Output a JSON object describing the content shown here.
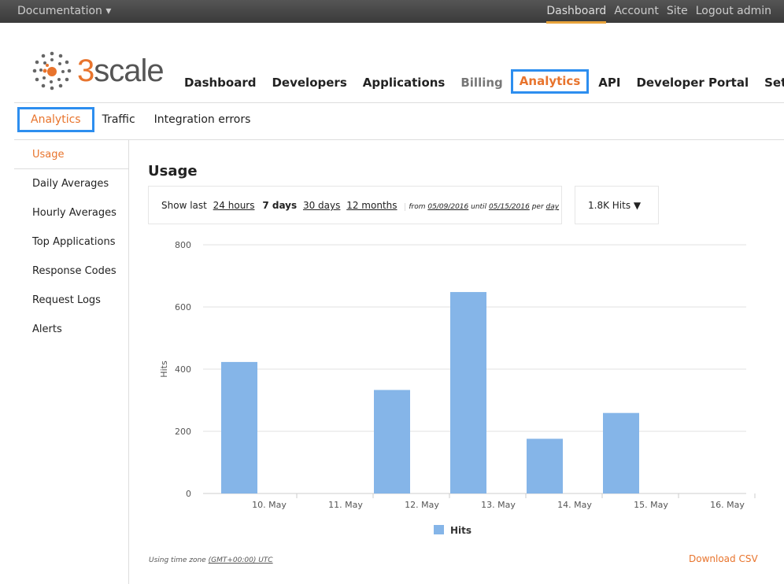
{
  "topbar": {
    "documentation": "Documentation",
    "links": [
      "Dashboard",
      "Account",
      "Site",
      "Logout admin"
    ],
    "active": "Dashboard"
  },
  "logo": {
    "prefix": "3",
    "rest": "scale"
  },
  "main_nav": [
    "Dashboard",
    "Developers",
    "Applications",
    "Billing",
    "Analytics",
    "API",
    "Developer Portal",
    "Settings"
  ],
  "sub_nav": [
    "Analytics",
    "Traffic",
    "Integration errors"
  ],
  "sidebar": [
    "Usage",
    "Daily Averages",
    "Hourly Averages",
    "Top Applications",
    "Response Codes",
    "Request Logs",
    "Alerts"
  ],
  "page_title": "Usage",
  "range": {
    "show_last": "Show last",
    "opt1": "24 hours",
    "opt2": "7 days",
    "opt3": "30 days",
    "opt4": "12 months",
    "from": "from",
    "from_date": "05/09/2016",
    "until": "until",
    "until_date": "05/15/2016",
    "per": "per",
    "period": "day"
  },
  "metric_select": "1.8K Hits",
  "chart_data": {
    "type": "bar",
    "categories": [
      "10. May",
      "11. May",
      "12. May",
      "13. May",
      "14. May",
      "15. May",
      "16. May"
    ],
    "series": [
      {
        "name": "Hits",
        "values": [
          423,
          0,
          333,
          648,
          176,
          259,
          0
        ]
      }
    ],
    "ylabel": "Hits",
    "ylim": [
      0,
      800
    ],
    "yticks": [
      0,
      200,
      400,
      600,
      800
    ],
    "grid": true,
    "legend": "bottom",
    "color": "#85b5e8"
  },
  "timezone": {
    "prefix": "Using time zone",
    "value": "(GMT+00:00) UTC"
  },
  "download": "Download CSV"
}
